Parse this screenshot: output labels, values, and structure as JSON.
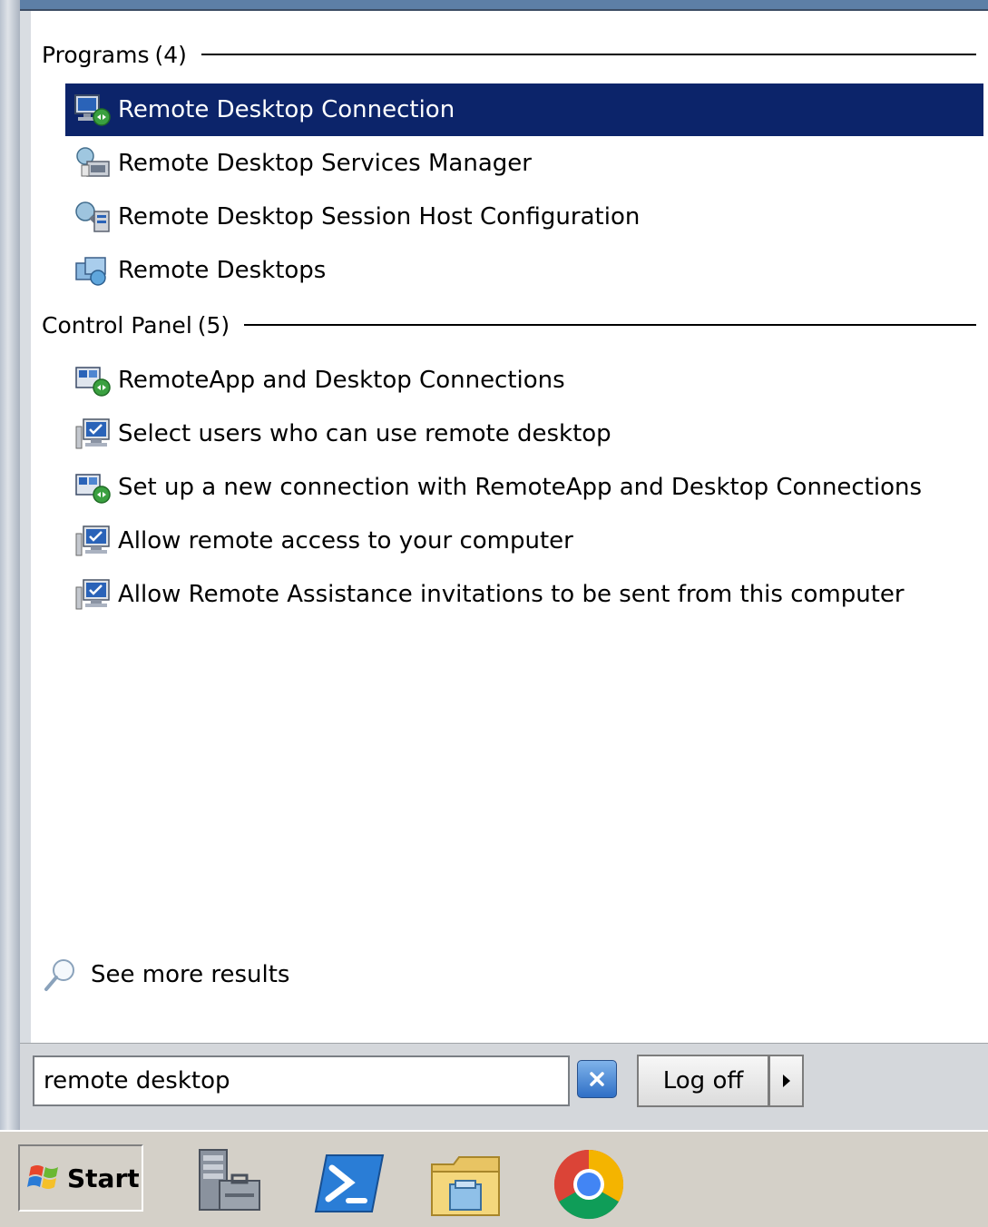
{
  "programs": {
    "title": "Programs",
    "count": "(4)",
    "items": [
      {
        "label": "Remote Desktop Connection",
        "icon": "remote-desktop-connection-icon",
        "selected": true
      },
      {
        "label": "Remote Desktop Services Manager",
        "icon": "services-manager-icon"
      },
      {
        "label": "Remote Desktop Session Host Configuration",
        "icon": "session-host-config-icon"
      },
      {
        "label": "Remote Desktops",
        "icon": "remote-desktops-icon"
      }
    ]
  },
  "control_panel": {
    "title": "Control Panel",
    "count": "(5)",
    "items": [
      {
        "label": "RemoteApp and Desktop Connections",
        "icon": "remoteapp-icon"
      },
      {
        "label": "Select users who can use remote desktop",
        "icon": "system-monitor-icon"
      },
      {
        "label": "Set up a new connection with RemoteApp and Desktop Connections",
        "icon": "remoteapp-icon"
      },
      {
        "label": "Allow remote access to your computer",
        "icon": "system-monitor-icon"
      },
      {
        "label": "Allow Remote Assistance invitations to be sent from this computer",
        "icon": "system-monitor-icon"
      }
    ]
  },
  "see_more": {
    "label": "See more results",
    "icon": "magnifier-icon"
  },
  "search": {
    "value": "remote desktop"
  },
  "log_off": {
    "label": "Log off"
  },
  "taskbar": {
    "start_label": "Start",
    "pinned": [
      "server-manager-icon",
      "powershell-icon",
      "explorer-icon",
      "chrome-icon"
    ]
  },
  "colors": {
    "selection": "#0c246a",
    "menu_body": "#ffffff",
    "taskbar": "#d4d0c8"
  }
}
